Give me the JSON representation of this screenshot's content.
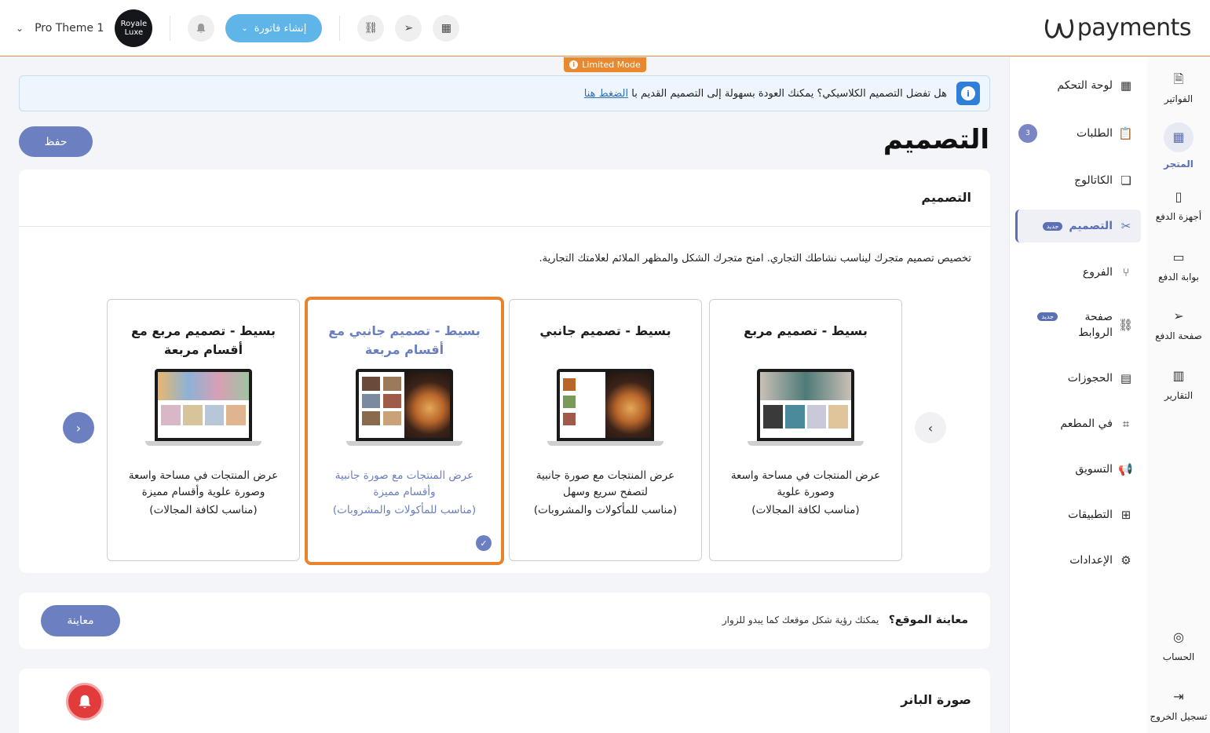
{
  "header": {
    "logo_text": "payments",
    "store_name": "Pro Theme 1",
    "avatar_text": "Royale Luxe",
    "invoice_button": "إنشاء فاتورة"
  },
  "limited_mode": "Limited Mode",
  "rail": [
    {
      "label": "الفواتير",
      "icon": "invoice-icon"
    },
    {
      "label": "المتجر",
      "icon": "store-icon",
      "active": true
    },
    {
      "label": "أجهزة الدفع",
      "icon": "pos-device-icon"
    },
    {
      "label": "بوابة الدفع",
      "icon": "gateway-icon"
    },
    {
      "label": "صفحة الدفع",
      "icon": "send-icon"
    },
    {
      "label": "التقارير",
      "icon": "reports-icon"
    },
    {
      "label": "الحساب",
      "icon": "account-icon"
    },
    {
      "label": "تسجيل الخروج",
      "icon": "logout-icon"
    }
  ],
  "menu": [
    {
      "label": "لوحة التحكم",
      "icon": "dashboard-icon"
    },
    {
      "label": "الطلبات",
      "icon": "orders-icon",
      "count": "3"
    },
    {
      "label": "الكاتالوج",
      "icon": "catalog-icon"
    },
    {
      "label": "التصميم",
      "icon": "design-icon",
      "badge": "جديد",
      "active": true
    },
    {
      "label": "الفروع",
      "icon": "branches-icon"
    },
    {
      "label": "صفحة الروابط",
      "icon": "links-icon",
      "badge": "جديد"
    },
    {
      "label": "الحجوزات",
      "icon": "calendar-icon"
    },
    {
      "label": "في المطعم",
      "icon": "qr-icon"
    },
    {
      "label": "التسويق",
      "icon": "megaphone-icon"
    },
    {
      "label": "التطبيقات",
      "icon": "apps-icon"
    },
    {
      "label": "الإعدادات",
      "icon": "settings-icon"
    }
  ],
  "notice": {
    "text": "هل تفضل التصميم الكلاسيكي؟ يمكنك العودة بسهولة إلى التصميم القديم با ",
    "link": "الضغط هنا"
  },
  "page_title": "التصميم",
  "save_button": "حفظ",
  "design_card": {
    "title": "التصميم",
    "description": "تخصيص تصميم متجرك ليناسب نشاطك التجاري. امنح متجرك الشكل والمظهر الملائم لعلامتك التجارية."
  },
  "themes": [
    {
      "title": "بسيط - تصميم مربع",
      "desc": "عرض المنتجات في مساحة واسعة وصورة علوية",
      "note": "(مناسب لكافة المجالات)",
      "selected": false
    },
    {
      "title": "بسيط - تصميم جانبي",
      "desc": "عرض المنتجات مع صورة جانبية لتصفح سريع وسهل",
      "note": "(مناسب للمأكولات والمشروبات)",
      "selected": false
    },
    {
      "title": "بسيط - تصميم جانبي مع أقسام مربعة",
      "desc": "عرض المنتجات مع صورة جانبية وأقسام مميزة",
      "note": "(مناسب للمأكولات والمشروبات)",
      "selected": true
    },
    {
      "title": "بسيط - تصميم مربع مع أقسام مربعة",
      "desc": "عرض المنتجات في مساحة واسعة وصورة علوية وأقسام مميزة",
      "note": "(مناسب لكافة المجالات)",
      "selected": false
    }
  ],
  "preview_card": {
    "question": "معاينة الموقع؟",
    "hint": "يمكنك رؤية شكل موقعك كما يبدو للزوار",
    "button": "معاينة"
  },
  "banner_card": {
    "title": "صورة البانر"
  },
  "colors": {
    "accent": "#6b7fc1",
    "selected_border": "#e8832e",
    "limited": "#e8892f"
  }
}
